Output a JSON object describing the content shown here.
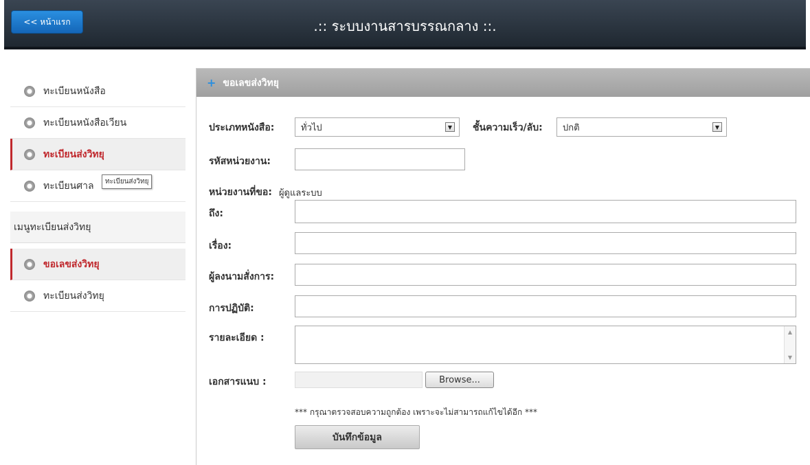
{
  "header": {
    "home_button": "<< หน้าแรก",
    "title": ".:: ระบบงานสารบรรณกลาง ::."
  },
  "sidebar": {
    "items": [
      {
        "label": "ทะเบียนหนังสือ"
      },
      {
        "label": "ทะเบียนหนังสือเวียน"
      },
      {
        "label": "ทะเบียนส่งวิทยุ"
      },
      {
        "label": "ทะเบียนศาล"
      }
    ],
    "tooltip": "ทะเบียนส่งวิทยุ",
    "submenu_heading": "เมนูทะเบียนส่งวิทยุ",
    "submenu_items": [
      {
        "label": "ขอเลขส่งวิทยุ"
      },
      {
        "label": "ทะเบียนส่งวิทยุ"
      }
    ]
  },
  "panel": {
    "title": "ขอเลขส่งวิทยุ",
    "doc_type_label": "ประเภทหนังสือ:",
    "doc_type_value": "ทั่วไป",
    "priority_label": "ชั้นความเร็ว/ลับ:",
    "priority_value": "ปกติ",
    "unit_code_label": "รหัสหน่วยงาน:",
    "requesting_unit_label": "หน่วยงานที่ขอ:",
    "requesting_unit_value": "ผู้ดูแลระบบ",
    "to_label": "ถึง:",
    "subject_label": "เรื่อง:",
    "signer_label": "ผู้ลงนามสั่งการ:",
    "action_label": "การปฏิบัติ:",
    "detail_label": "รายละเอียด :",
    "attachment_label": "เอกสารแนบ :",
    "browse_label": "Browse...",
    "notice": "*** กรุณาตรวจสอบความถูกต้อง เพราะจะไม่สามารถแก้ไขได้อีก ***",
    "save_label": "บันทึกข้อมูล"
  },
  "icons": {
    "bullet": "radio-bullet-icon",
    "plus": "plus-icon",
    "select_arrow": "chevron-down-icon"
  },
  "colors": {
    "accent_red": "#c0282d",
    "home_blue": "#1f7bd0",
    "header_dark": "#2b343e"
  }
}
